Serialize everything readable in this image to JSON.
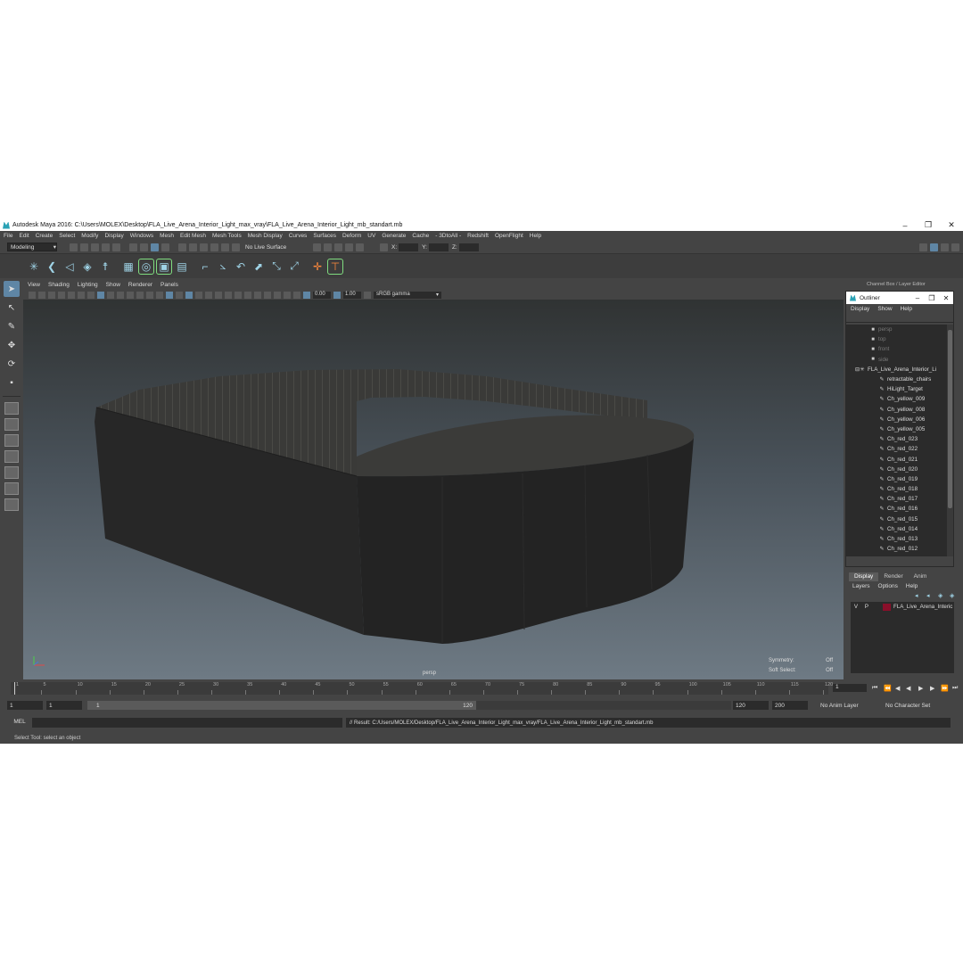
{
  "window": {
    "title": "Autodesk Maya 2016: C:\\Users\\MOLEX\\Desktop\\FLA_Live_Arena_Interior_Light_max_vray\\FLA_Live_Arena_Interior_Light_mb_standart.mb",
    "min": "–",
    "max": "❐",
    "close": "✕"
  },
  "menubar": [
    "File",
    "Edit",
    "Create",
    "Select",
    "Modify",
    "Display",
    "Windows",
    "Mesh",
    "Edit Mesh",
    "Mesh Tools",
    "Mesh Display",
    "Curves",
    "Surfaces",
    "Deform",
    "UV",
    "Generate",
    "Cache",
    "- 3DtoAll -",
    "Redshift",
    "OpenFlight",
    "Help"
  ],
  "statusline": {
    "mode": "Modeling",
    "no_live": "No Live Surface",
    "x": "X:",
    "y": "Y:",
    "z": "Z:"
  },
  "panel": {
    "menus": [
      "View",
      "Shading",
      "Lighting",
      "Show",
      "Renderer",
      "Panels"
    ],
    "exposure": "0.00",
    "gamma_value": "1.00",
    "color_space": "sRGB gamma",
    "camera": "persp",
    "symmetry_label": "Symmetry:",
    "symmetry_value": "Off",
    "soft_select_label": "Soft Select:",
    "soft_select_value": "Off"
  },
  "channel_box": {
    "title": "Channel Box / Layer Editor"
  },
  "outliner": {
    "title": "Outliner",
    "menus": [
      "Display",
      "Show",
      "Help"
    ],
    "items": [
      {
        "label": "persp",
        "icon": "camera-icon",
        "indent": 1,
        "dim": true
      },
      {
        "label": "top",
        "icon": "camera-icon",
        "indent": 1,
        "dim": true
      },
      {
        "label": "front",
        "icon": "camera-icon",
        "indent": 1,
        "dim": true
      },
      {
        "label": "side",
        "icon": "camera-icon",
        "indent": 1,
        "dim": true
      },
      {
        "label": "FLA_Live_Arena_Interior_Li",
        "icon": "group-icon",
        "indent": 0,
        "dim": false
      },
      {
        "label": "retractable_chairs",
        "icon": "mesh-icon",
        "indent": 2,
        "dim": false
      },
      {
        "label": "HiLight_Target",
        "icon": "mesh-icon",
        "indent": 2,
        "dim": false
      },
      {
        "label": "Ch_yellow_009",
        "icon": "mesh-icon",
        "indent": 2,
        "dim": false
      },
      {
        "label": "Ch_yellow_008",
        "icon": "mesh-icon",
        "indent": 2,
        "dim": false
      },
      {
        "label": "Ch_yellow_006",
        "icon": "mesh-icon",
        "indent": 2,
        "dim": false
      },
      {
        "label": "Ch_yellow_005",
        "icon": "mesh-icon",
        "indent": 2,
        "dim": false
      },
      {
        "label": "Ch_red_023",
        "icon": "mesh-icon",
        "indent": 2,
        "dim": false
      },
      {
        "label": "Ch_red_022",
        "icon": "mesh-icon",
        "indent": 2,
        "dim": false
      },
      {
        "label": "Ch_red_021",
        "icon": "mesh-icon",
        "indent": 2,
        "dim": false
      },
      {
        "label": "Ch_red_020",
        "icon": "mesh-icon",
        "indent": 2,
        "dim": false
      },
      {
        "label": "Ch_red_019",
        "icon": "mesh-icon",
        "indent": 2,
        "dim": false
      },
      {
        "label": "Ch_red_018",
        "icon": "mesh-icon",
        "indent": 2,
        "dim": false
      },
      {
        "label": "Ch_red_017",
        "icon": "mesh-icon",
        "indent": 2,
        "dim": false
      },
      {
        "label": "Ch_red_016",
        "icon": "mesh-icon",
        "indent": 2,
        "dim": false
      },
      {
        "label": "Ch_red_015",
        "icon": "mesh-icon",
        "indent": 2,
        "dim": false
      },
      {
        "label": "Ch_red_014",
        "icon": "mesh-icon",
        "indent": 2,
        "dim": false
      },
      {
        "label": "Ch_red_013",
        "icon": "mesh-icon",
        "indent": 2,
        "dim": false
      },
      {
        "label": "Ch_red_012",
        "icon": "mesh-icon",
        "indent": 2,
        "dim": false
      }
    ]
  },
  "layer_editor": {
    "tabs": [
      "Display",
      "Render",
      "Anim"
    ],
    "active_tab": "Display",
    "menus": [
      "Layers",
      "Options",
      "Help"
    ],
    "layers": [
      {
        "v": "V",
        "p": "P",
        "color": "#8a0f2a",
        "name": "FLA_Live_Arena_Interic"
      }
    ]
  },
  "timeline": {
    "ticks": [
      "1",
      "5",
      "10",
      "15",
      "20",
      "25",
      "30",
      "35",
      "40",
      "45",
      "50",
      "55",
      "60",
      "65",
      "70",
      "75",
      "80",
      "85",
      "90",
      "95",
      "100",
      "105",
      "110",
      "115",
      "120"
    ],
    "current_frame": "1"
  },
  "range": {
    "start": "1",
    "playback_start": "1",
    "range_start_label": "1",
    "range_end_label": "120",
    "playback_end": "120",
    "end": "200",
    "anim_layer": "No Anim Layer",
    "char_set": "No Character Set"
  },
  "command": {
    "lang": "MEL",
    "result": "// Result: C:/Users/MOLEX/Desktop/FLA_Live_Arena_Interior_Light_max_vray/FLA_Live_Arena_Interior_Light_mb_standart.mb"
  },
  "help_line": "Select Tool: select an object"
}
